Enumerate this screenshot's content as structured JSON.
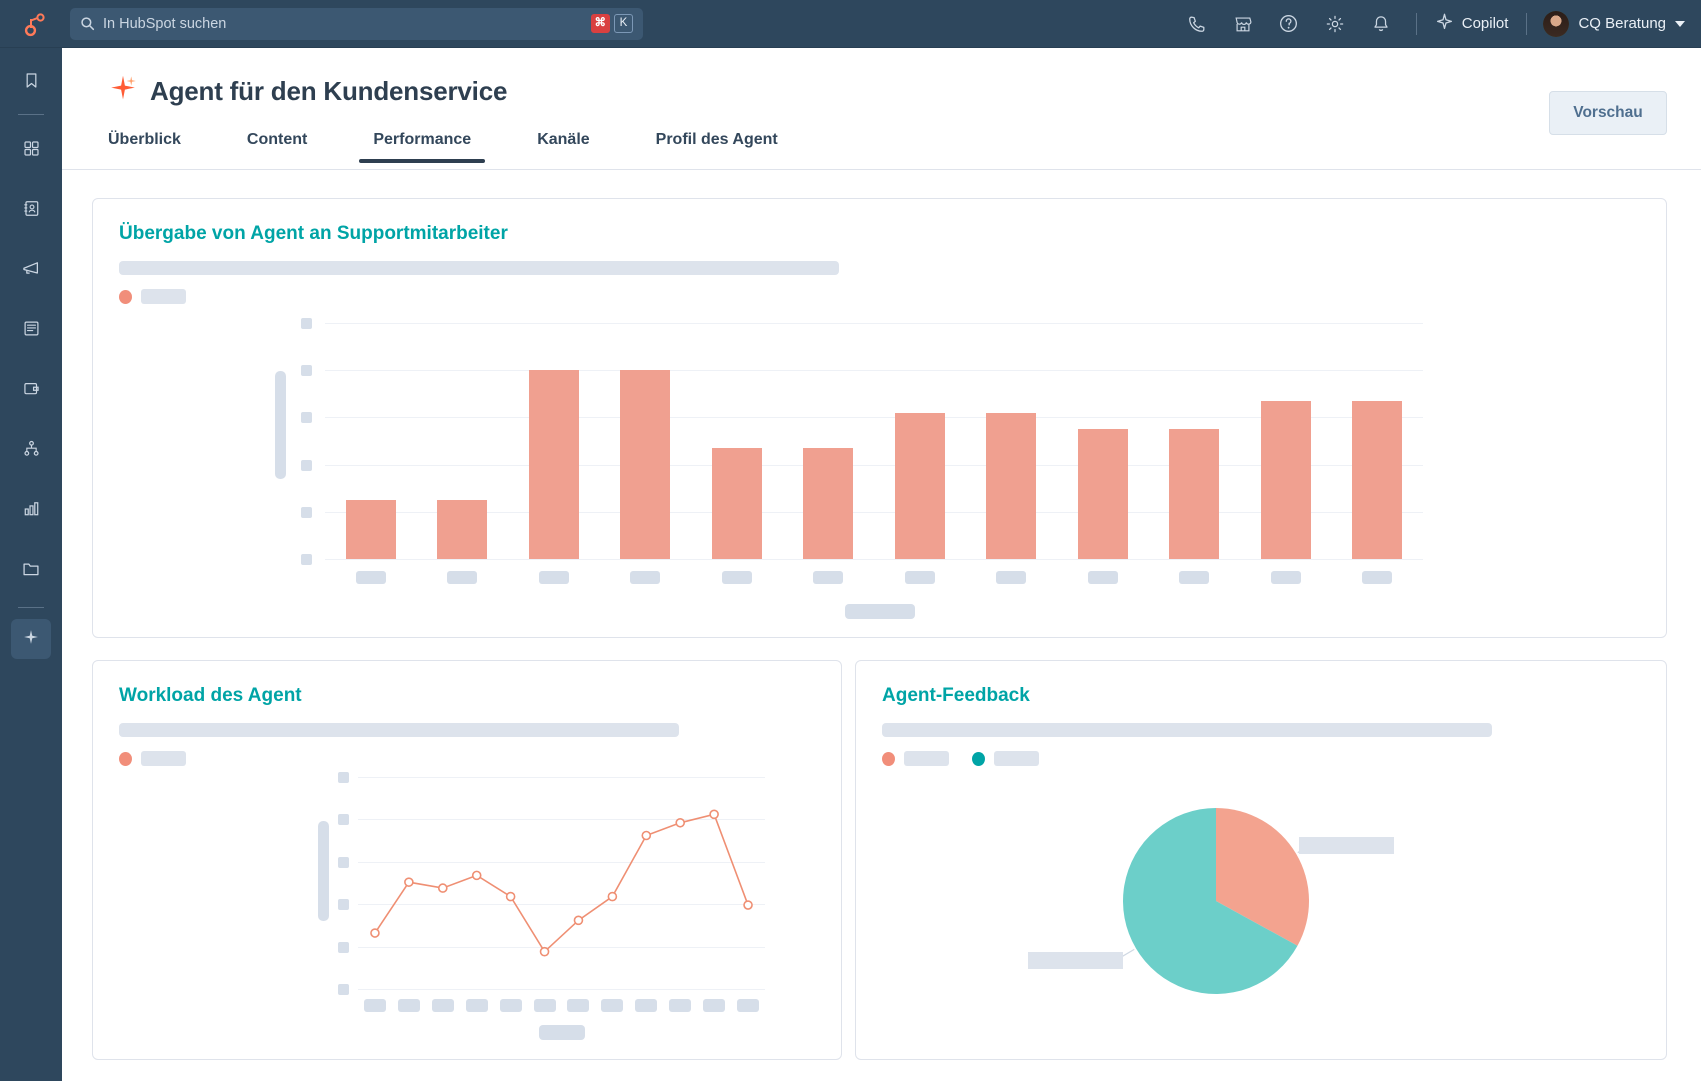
{
  "topnav": {
    "logo_name": "hubspot-logo",
    "search": {
      "placeholder": "In HubSpot suchen",
      "icon": "search-icon",
      "shortcut_modifier": "⌘",
      "shortcut_key": "K"
    },
    "icons": [
      {
        "name": "phone-icon",
        "label": "Telefon"
      },
      {
        "name": "marketplace-icon",
        "label": "Marketplace"
      },
      {
        "name": "help-icon",
        "label": "Hilfe"
      },
      {
        "name": "settings-gear-icon",
        "label": "Einstellungen"
      },
      {
        "name": "notifications-bell-icon",
        "label": "Benachrichtigungen"
      }
    ],
    "copilot": {
      "label": "Copilot",
      "icon": "sparkle-icon"
    },
    "account": {
      "name": "CQ Beratung",
      "caret": "chevron-down-icon"
    }
  },
  "sidebar": {
    "items": [
      {
        "name": "bookmark-icon",
        "label": "Lesezeichen",
        "active": false
      },
      {
        "name": "workspaces-grid-icon",
        "label": "Workspaces",
        "active": false
      },
      {
        "name": "contacts-icon",
        "label": "Kontakte",
        "active": false
      },
      {
        "name": "marketing-megaphone-icon",
        "label": "Marketing",
        "active": false
      },
      {
        "name": "content-document-icon",
        "label": "Content",
        "active": false
      },
      {
        "name": "commerce-wallet-icon",
        "label": "Commerce",
        "active": false
      },
      {
        "name": "automation-workflow-icon",
        "label": "Automatisierung",
        "active": false
      },
      {
        "name": "reporting-bar-chart-icon",
        "label": "Reporting",
        "active": false
      },
      {
        "name": "library-folder-icon",
        "label": "Bibliothek",
        "active": false
      },
      {
        "name": "ai-agent-sparkle-icon",
        "label": "AI Agent",
        "active": true
      }
    ]
  },
  "header": {
    "title": "Agent für den Kundenservice",
    "title_icon": "sparkle-icon",
    "preview_button": "Vorschau",
    "tabs": [
      {
        "label": "Überblick",
        "active": false
      },
      {
        "label": "Content",
        "active": false
      },
      {
        "label": "Performance",
        "active": true
      },
      {
        "label": "Kanäle",
        "active": false
      },
      {
        "label": "Profil des Agent",
        "active": false
      }
    ]
  },
  "cards": {
    "handoff": {
      "title": "Übergabe von Agent an Supportmitarbeiter"
    },
    "workload": {
      "title": "Workload des Agent"
    },
    "feedback": {
      "title": "Agent-Feedback"
    }
  },
  "colors": {
    "teal": "#00a4a6",
    "coral": "#f0a090",
    "coral_line": "#ef8f73",
    "pie_teal": "#6ccfc9",
    "pie_coral": "#f3a38f",
    "skeleton": "#dde3ec",
    "navy": "#2e475d"
  },
  "chart_data": [
    {
      "type": "bar",
      "title": "Übergabe von Agent an Supportmitarbeiter",
      "xlabel": "",
      "ylabel": "",
      "categories": [
        "",
        "",
        "",
        "",
        "",
        "",
        "",
        "",
        "",
        "",
        "",
        ""
      ],
      "values": [
        1.25,
        1.25,
        4.0,
        4.0,
        2.35,
        2.35,
        3.1,
        3.1,
        2.75,
        2.75,
        3.35,
        3.35
      ],
      "ylim": [
        0,
        5
      ],
      "yticks": [
        0,
        1,
        2,
        3,
        4,
        5
      ],
      "grid": true,
      "legend": [
        ""
      ],
      "skeleton_state": true,
      "series": [
        {
          "name": "",
          "color": "#f0a090",
          "values": [
            1.25,
            1.25,
            4.0,
            4.0,
            2.35,
            2.35,
            3.1,
            3.1,
            2.75,
            2.75,
            3.35,
            3.35
          ]
        }
      ]
    },
    {
      "type": "line",
      "title": "Workload des Agent",
      "xlabel": "",
      "ylabel": "",
      "categories": [
        "",
        "",
        "",
        "",
        "",
        "",
        "",
        "",
        "",
        "",
        "",
        ""
      ],
      "values": [
        1.32,
        2.52,
        2.38,
        2.68,
        2.18,
        0.88,
        1.62,
        2.18,
        3.62,
        3.92,
        4.12,
        1.98
      ],
      "ylim": [
        0,
        5
      ],
      "yticks": [
        0,
        1,
        2,
        3,
        4,
        5
      ],
      "grid": true,
      "skeleton_state": true,
      "series": [
        {
          "name": "",
          "color": "#ef8f73",
          "values": [
            1.32,
            2.52,
            2.38,
            2.68,
            2.18,
            0.88,
            1.62,
            2.18,
            3.62,
            3.92,
            4.12,
            1.98
          ]
        }
      ]
    },
    {
      "type": "pie",
      "title": "Agent-Feedback",
      "labels": [
        "",
        ""
      ],
      "values": [
        33,
        67
      ],
      "colors": [
        "#f3a38f",
        "#6ccfc9"
      ],
      "legend_position": "top",
      "skeleton_state": true
    }
  ]
}
